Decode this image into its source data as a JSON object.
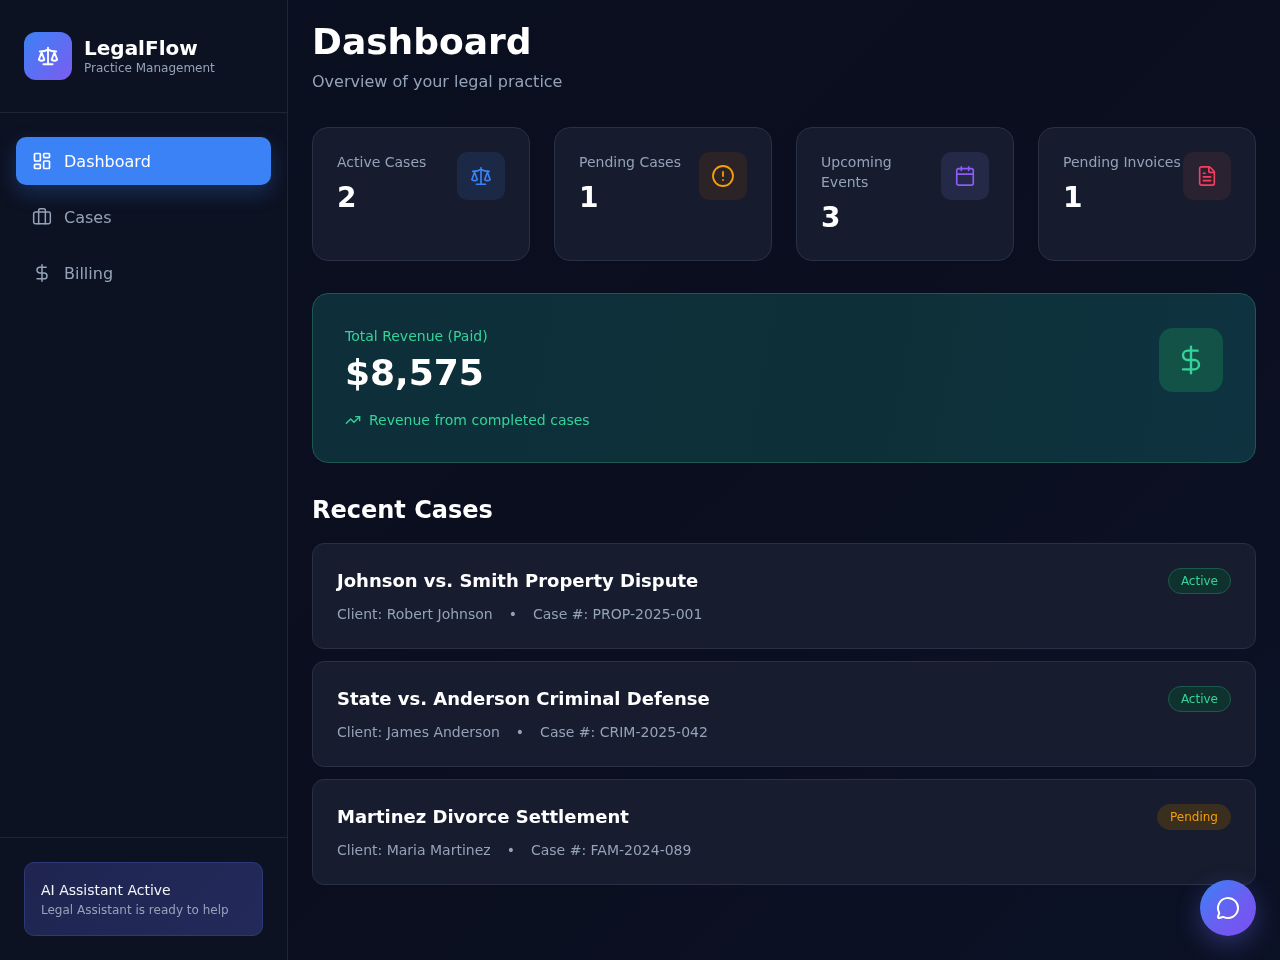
{
  "sidebar": {
    "brand": {
      "name": "LegalFlow",
      "tagline": "Practice Management"
    },
    "nav": [
      {
        "label": "Dashboard",
        "kind": "dashboard",
        "selected": true
      },
      {
        "label": "Cases",
        "kind": "cases",
        "selected": false
      },
      {
        "label": "Billing",
        "kind": "billing",
        "selected": false
      }
    ],
    "assistant": {
      "title": "AI Assistant Active",
      "subtitle": "Legal Assistant is ready to help"
    }
  },
  "header": {
    "title": "Dashboard",
    "subtitle": "Overview of your legal practice"
  },
  "stats": [
    {
      "label": "Active Cases",
      "value": "2",
      "kind": "cases"
    },
    {
      "label": "Pending Cases",
      "value": "1",
      "kind": "pending"
    },
    {
      "label": "Upcoming Events",
      "value": "3",
      "kind": "events"
    },
    {
      "label": "Pending Invoices",
      "value": "1",
      "kind": "invoices"
    }
  ],
  "revenue": {
    "label": "Total Revenue (Paid)",
    "value": "$8,575",
    "note": "Revenue from completed cases"
  },
  "recent_cases": {
    "title": "Recent Cases",
    "cases": [
      {
        "title": "Johnson vs. Smith Property Dispute",
        "client": "Client: Robert Johnson",
        "separator": "•",
        "case_number": "Case #: PROP-2025-001",
        "status": {
          "label": "Active",
          "kind": "active"
        }
      },
      {
        "title": "State vs. Anderson Criminal Defense",
        "client": "Client: James Anderson",
        "separator": "•",
        "case_number": "Case #: CRIM-2025-042",
        "status": {
          "label": "Active",
          "kind": "active"
        }
      },
      {
        "title": "Martinez Divorce Settlement",
        "client": "Client: Maria Martinez",
        "separator": "•",
        "case_number": "Case #: FAM-2024-089",
        "status": {
          "label": "Pending",
          "kind": "pending"
        }
      }
    ]
  }
}
